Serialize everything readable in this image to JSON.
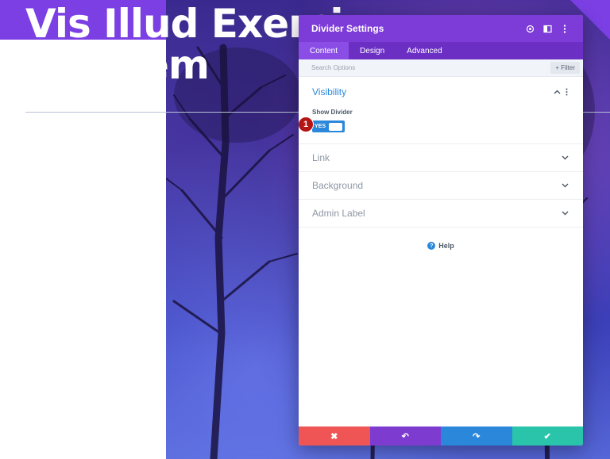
{
  "page": {
    "hero_title": "Vis Illud Exerci\n       critatem"
  },
  "modal": {
    "title": "Divider Settings",
    "header_icons": [
      "target-icon",
      "split-view-icon",
      "more-icon"
    ],
    "tabs": [
      {
        "label": "Content",
        "active": true
      },
      {
        "label": "Design",
        "active": false
      },
      {
        "label": "Advanced",
        "active": false
      }
    ],
    "search": {
      "placeholder": "Search Options",
      "filter_label": "+ Filter"
    },
    "sections": {
      "visibility": {
        "title": "Visibility",
        "field_label": "Show Divider",
        "toggle_value": "YES",
        "step_number": "1"
      },
      "link": {
        "title": "Link"
      },
      "background": {
        "title": "Background"
      },
      "admin_label": {
        "title": "Admin Label"
      }
    },
    "help_label": "Help",
    "footer": {
      "cancel_icon": "✖",
      "undo_icon": "↶",
      "redo_icon": "↷",
      "save_icon": "✔"
    }
  },
  "colors": {
    "accent_purple": "#7d3bd8",
    "tab_bar": "#6c2fc4",
    "link_blue": "#2b87da",
    "cancel_red": "#ef5555",
    "undo_purple": "#7e3bd0",
    "redo_blue": "#2b87da",
    "save_green": "#29c4a9",
    "badge_red": "#b31414"
  }
}
